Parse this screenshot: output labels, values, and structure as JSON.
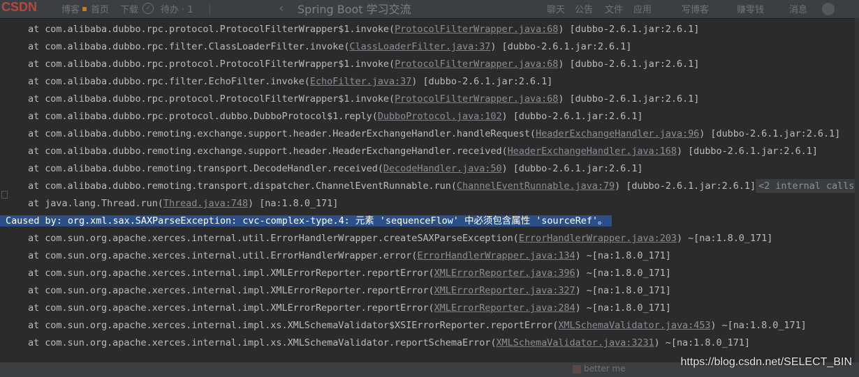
{
  "browser": {
    "logo": "CSDN",
    "tabs": [
      "博客",
      "首页",
      "下载"
    ],
    "todo_label": "待办 · 1",
    "title": "Spring Boot 学习交流",
    "chat_links": [
      "聊天",
      "公告",
      "文件",
      "应用"
    ],
    "right_links": [
      "写博客",
      "赚零钱",
      "消息"
    ]
  },
  "console": {
    "lines": [
      {
        "text": "at com.alibaba.dubbo.rpc.protocol.ProtocolFilterWrapper$1.invoke(",
        "link": "ProtocolFilterWrapper.java:68",
        "suffix": ") [dubbo-2.6.1.jar:2.6.1]"
      },
      {
        "text": "at com.alibaba.dubbo.rpc.filter.ClassLoaderFilter.invoke(",
        "link": "ClassLoaderFilter.java:37",
        "suffix": ") [dubbo-2.6.1.jar:2.6.1]"
      },
      {
        "text": "at com.alibaba.dubbo.rpc.protocol.ProtocolFilterWrapper$1.invoke(",
        "link": "ProtocolFilterWrapper.java:68",
        "suffix": ") [dubbo-2.6.1.jar:2.6.1]"
      },
      {
        "text": "at com.alibaba.dubbo.rpc.filter.EchoFilter.invoke(",
        "link": "EchoFilter.java:37",
        "suffix": ") [dubbo-2.6.1.jar:2.6.1]"
      },
      {
        "text": "at com.alibaba.dubbo.rpc.protocol.ProtocolFilterWrapper$1.invoke(",
        "link": "ProtocolFilterWrapper.java:68",
        "suffix": ") [dubbo-2.6.1.jar:2.6.1]"
      },
      {
        "text": "at com.alibaba.dubbo.rpc.protocol.dubbo.DubboProtocol$1.reply(",
        "link": "DubboProtocol.java:102",
        "suffix": ") [dubbo-2.6.1.jar:2.6.1]"
      },
      {
        "text": "at com.alibaba.dubbo.remoting.exchange.support.header.HeaderExchangeHandler.handleRequest(",
        "link": "HeaderExchangeHandler.java:96",
        "suffix": ") [dubbo-2.6.1.jar:2.6.1]"
      },
      {
        "text": "at com.alibaba.dubbo.remoting.exchange.support.header.HeaderExchangeHandler.received(",
        "link": "HeaderExchangeHandler.java:168",
        "suffix": ") [dubbo-2.6.1.jar:2.6.1]"
      },
      {
        "text": "at com.alibaba.dubbo.remoting.transport.DecodeHandler.received(",
        "link": "DecodeHandler.java:50",
        "suffix": ") [dubbo-2.6.1.jar:2.6.1]"
      },
      {
        "text": "at com.alibaba.dubbo.remoting.transport.dispatcher.ChannelEventRunnable.run(",
        "link": "ChannelEventRunnable.java:79",
        "suffix": ") [dubbo-2.6.1.jar:2.6.1]",
        "internal": "<2 internal calls>"
      },
      {
        "text": "at java.lang.Thread.run(",
        "link": "Thread.java:748",
        "suffix": ") [na:1.8.0_171]"
      },
      {
        "text": "at com.sun.org.apache.xerces.internal.util.ErrorHandlerWrapper.createSAXParseException(",
        "link": "ErrorHandlerWrapper.java:203",
        "suffix": ") ~[na:1.8.0_171]"
      },
      {
        "text": "at com.sun.org.apache.xerces.internal.util.ErrorHandlerWrapper.error(",
        "link": "ErrorHandlerWrapper.java:134",
        "suffix": ") ~[na:1.8.0_171]"
      },
      {
        "text": "at com.sun.org.apache.xerces.internal.impl.XMLErrorReporter.reportError(",
        "link": "XMLErrorReporter.java:396",
        "suffix": ") ~[na:1.8.0_171]"
      },
      {
        "text": "at com.sun.org.apache.xerces.internal.impl.XMLErrorReporter.reportError(",
        "link": "XMLErrorReporter.java:327",
        "suffix": ") ~[na:1.8.0_171]"
      },
      {
        "text": "at com.sun.org.apache.xerces.internal.impl.XMLErrorReporter.reportError(",
        "link": "XMLErrorReporter.java:284",
        "suffix": ") ~[na:1.8.0_171]"
      },
      {
        "text": "at com.sun.org.apache.xerces.internal.impl.xs.XMLSchemaValidator$XSIErrorReporter.reportError(",
        "link": "XMLSchemaValidator.java:453",
        "suffix": ") ~[na:1.8.0_171]"
      },
      {
        "text": "at com.sun.org.apache.xerces.internal.impl.xs.XMLSchemaValidator.reportSchemaError(",
        "link": "XMLSchemaValidator.java:3231",
        "suffix": ") ~[na:1.8.0_171]"
      }
    ],
    "caused_by": "Caused by: org.xml.sax.SAXParseException: cvc-complex-type.4: 元素 'sequenceFlow' 中必须包含属性 'sourceRef'。"
  },
  "footer": {
    "ghost_text": "better me",
    "watermark": "https://blog.csdn.net/SELECT_BIN"
  },
  "colors": {
    "background": "#2b2b2b",
    "text": "#bbbbbb",
    "link": "#8a8f94",
    "selection": "#2d4f87"
  }
}
